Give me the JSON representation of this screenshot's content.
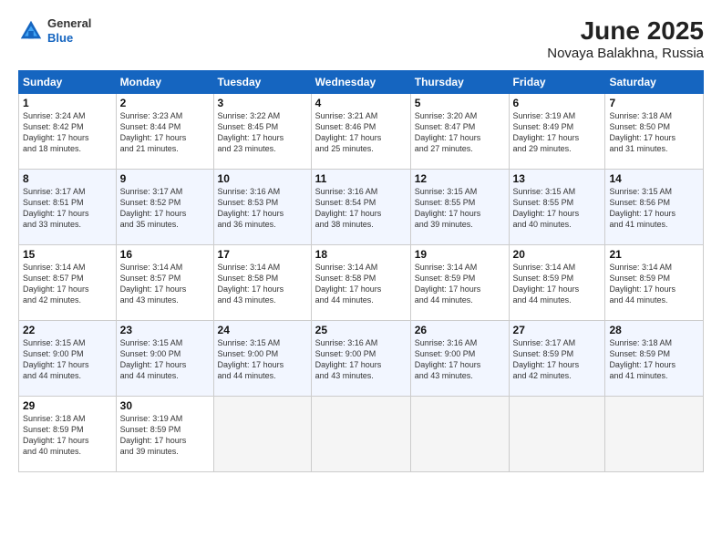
{
  "header": {
    "logo_line1": "General",
    "logo_line2": "Blue",
    "title": "June 2025",
    "subtitle": "Novaya Balakhna, Russia"
  },
  "days_of_week": [
    "Sunday",
    "Monday",
    "Tuesday",
    "Wednesday",
    "Thursday",
    "Friday",
    "Saturday"
  ],
  "weeks": [
    [
      {
        "day": "1",
        "info": "Sunrise: 3:24 AM\nSunset: 8:42 PM\nDaylight: 17 hours\nand 18 minutes."
      },
      {
        "day": "2",
        "info": "Sunrise: 3:23 AM\nSunset: 8:44 PM\nDaylight: 17 hours\nand 21 minutes."
      },
      {
        "day": "3",
        "info": "Sunrise: 3:22 AM\nSunset: 8:45 PM\nDaylight: 17 hours\nand 23 minutes."
      },
      {
        "day": "4",
        "info": "Sunrise: 3:21 AM\nSunset: 8:46 PM\nDaylight: 17 hours\nand 25 minutes."
      },
      {
        "day": "5",
        "info": "Sunrise: 3:20 AM\nSunset: 8:47 PM\nDaylight: 17 hours\nand 27 minutes."
      },
      {
        "day": "6",
        "info": "Sunrise: 3:19 AM\nSunset: 8:49 PM\nDaylight: 17 hours\nand 29 minutes."
      },
      {
        "day": "7",
        "info": "Sunrise: 3:18 AM\nSunset: 8:50 PM\nDaylight: 17 hours\nand 31 minutes."
      }
    ],
    [
      {
        "day": "8",
        "info": "Sunrise: 3:17 AM\nSunset: 8:51 PM\nDaylight: 17 hours\nand 33 minutes."
      },
      {
        "day": "9",
        "info": "Sunrise: 3:17 AM\nSunset: 8:52 PM\nDaylight: 17 hours\nand 35 minutes."
      },
      {
        "day": "10",
        "info": "Sunrise: 3:16 AM\nSunset: 8:53 PM\nDaylight: 17 hours\nand 36 minutes."
      },
      {
        "day": "11",
        "info": "Sunrise: 3:16 AM\nSunset: 8:54 PM\nDaylight: 17 hours\nand 38 minutes."
      },
      {
        "day": "12",
        "info": "Sunrise: 3:15 AM\nSunset: 8:55 PM\nDaylight: 17 hours\nand 39 minutes."
      },
      {
        "day": "13",
        "info": "Sunrise: 3:15 AM\nSunset: 8:55 PM\nDaylight: 17 hours\nand 40 minutes."
      },
      {
        "day": "14",
        "info": "Sunrise: 3:15 AM\nSunset: 8:56 PM\nDaylight: 17 hours\nand 41 minutes."
      }
    ],
    [
      {
        "day": "15",
        "info": "Sunrise: 3:14 AM\nSunset: 8:57 PM\nDaylight: 17 hours\nand 42 minutes."
      },
      {
        "day": "16",
        "info": "Sunrise: 3:14 AM\nSunset: 8:57 PM\nDaylight: 17 hours\nand 43 minutes."
      },
      {
        "day": "17",
        "info": "Sunrise: 3:14 AM\nSunset: 8:58 PM\nDaylight: 17 hours\nand 43 minutes."
      },
      {
        "day": "18",
        "info": "Sunrise: 3:14 AM\nSunset: 8:58 PM\nDaylight: 17 hours\nand 44 minutes."
      },
      {
        "day": "19",
        "info": "Sunrise: 3:14 AM\nSunset: 8:59 PM\nDaylight: 17 hours\nand 44 minutes."
      },
      {
        "day": "20",
        "info": "Sunrise: 3:14 AM\nSunset: 8:59 PM\nDaylight: 17 hours\nand 44 minutes."
      },
      {
        "day": "21",
        "info": "Sunrise: 3:14 AM\nSunset: 8:59 PM\nDaylight: 17 hours\nand 44 minutes."
      }
    ],
    [
      {
        "day": "22",
        "info": "Sunrise: 3:15 AM\nSunset: 9:00 PM\nDaylight: 17 hours\nand 44 minutes."
      },
      {
        "day": "23",
        "info": "Sunrise: 3:15 AM\nSunset: 9:00 PM\nDaylight: 17 hours\nand 44 minutes."
      },
      {
        "day": "24",
        "info": "Sunrise: 3:15 AM\nSunset: 9:00 PM\nDaylight: 17 hours\nand 44 minutes."
      },
      {
        "day": "25",
        "info": "Sunrise: 3:16 AM\nSunset: 9:00 PM\nDaylight: 17 hours\nand 43 minutes."
      },
      {
        "day": "26",
        "info": "Sunrise: 3:16 AM\nSunset: 9:00 PM\nDaylight: 17 hours\nand 43 minutes."
      },
      {
        "day": "27",
        "info": "Sunrise: 3:17 AM\nSunset: 8:59 PM\nDaylight: 17 hours\nand 42 minutes."
      },
      {
        "day": "28",
        "info": "Sunrise: 3:18 AM\nSunset: 8:59 PM\nDaylight: 17 hours\nand 41 minutes."
      }
    ],
    [
      {
        "day": "29",
        "info": "Sunrise: 3:18 AM\nSunset: 8:59 PM\nDaylight: 17 hours\nand 40 minutes."
      },
      {
        "day": "30",
        "info": "Sunrise: 3:19 AM\nSunset: 8:59 PM\nDaylight: 17 hours\nand 39 minutes."
      },
      {
        "day": "",
        "info": ""
      },
      {
        "day": "",
        "info": ""
      },
      {
        "day": "",
        "info": ""
      },
      {
        "day": "",
        "info": ""
      },
      {
        "day": "",
        "info": ""
      }
    ]
  ]
}
